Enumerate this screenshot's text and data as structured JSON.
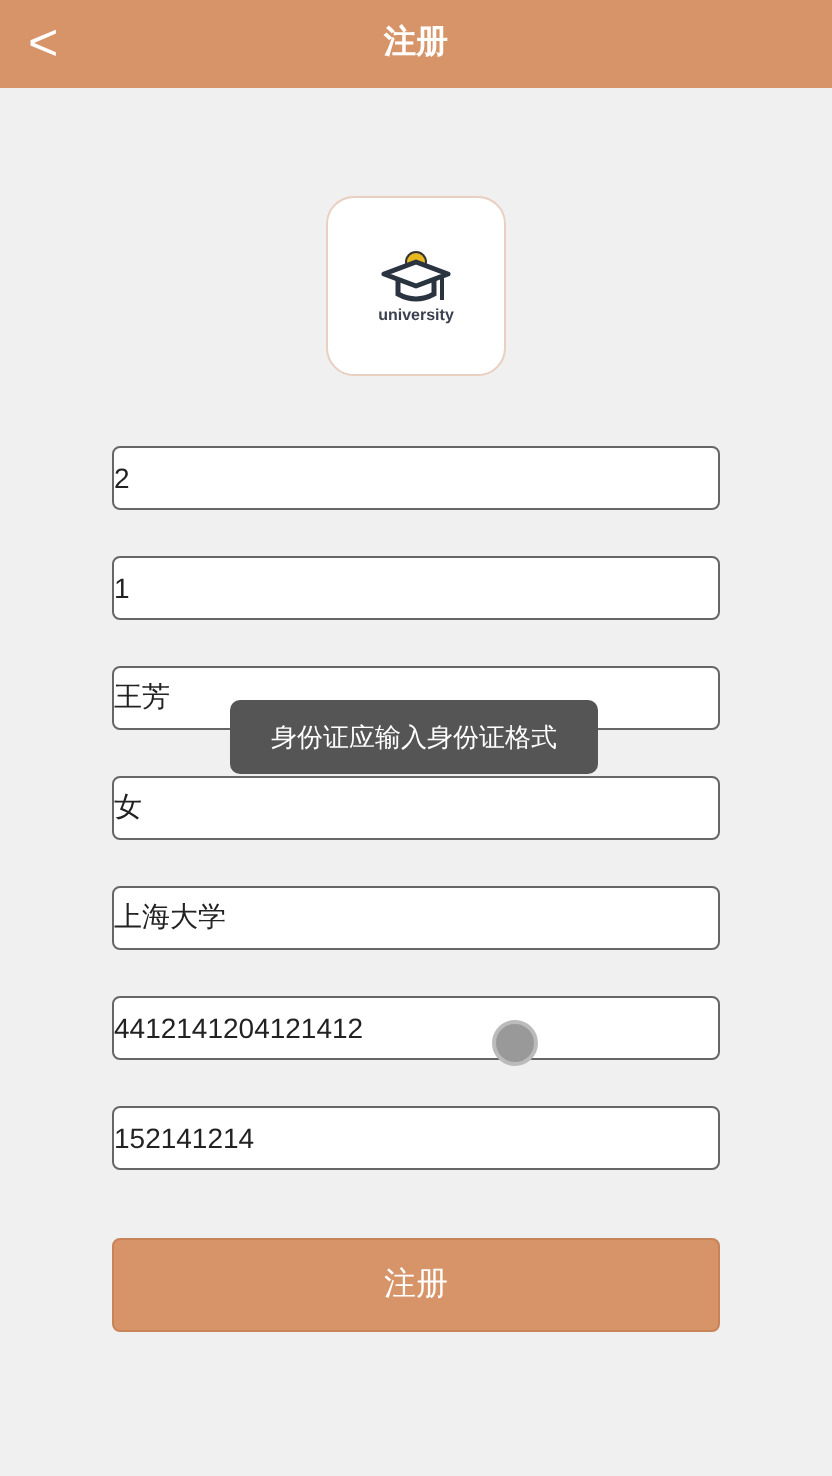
{
  "header": {
    "back_icon": "<",
    "title": "注册"
  },
  "logo": {
    "caption": "university"
  },
  "fields": [
    {
      "value": "2"
    },
    {
      "value": "1"
    },
    {
      "value": "王芳"
    },
    {
      "value": "女"
    },
    {
      "value": "上海大学"
    },
    {
      "value": "4412141204121412"
    },
    {
      "value": "152141214"
    }
  ],
  "submit": "注册",
  "toast": "身份证应输入身份证格式"
}
